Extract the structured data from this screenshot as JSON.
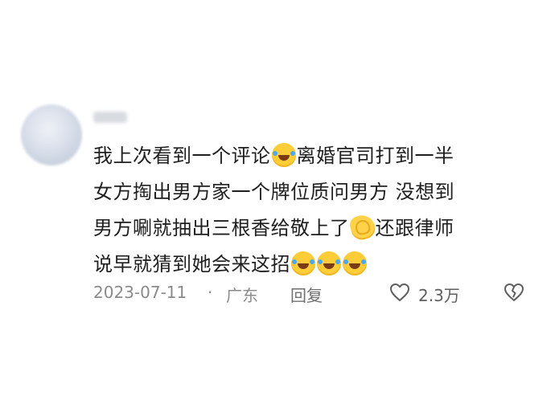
{
  "comment": {
    "lines": [
      [
        "我上次看到一个评论",
        "离婚官司打到一半"
      ],
      [
        "女方掏出男方家一个牌位质问男方 没想到"
      ],
      [
        "男方唰就抽出三根香给敬上了",
        "还跟律师"
      ],
      [
        "说早就猜到她会来这招"
      ]
    ],
    "emojis": [
      "laugh-cry-emoji",
      "pray-emoji",
      "laugh-cry-emoji"
    ]
  },
  "meta": {
    "date": "2023-07-11",
    "separator": "·",
    "location": "广东",
    "reply_label": "回复",
    "like_count": "2.3万"
  },
  "icons": {
    "like": "heart-icon",
    "dislike": "broken-heart-icon"
  },
  "colors": {
    "text": "#1f1f1f",
    "meta_text": "#8a8a8a",
    "emoji": "#ffcd38"
  }
}
